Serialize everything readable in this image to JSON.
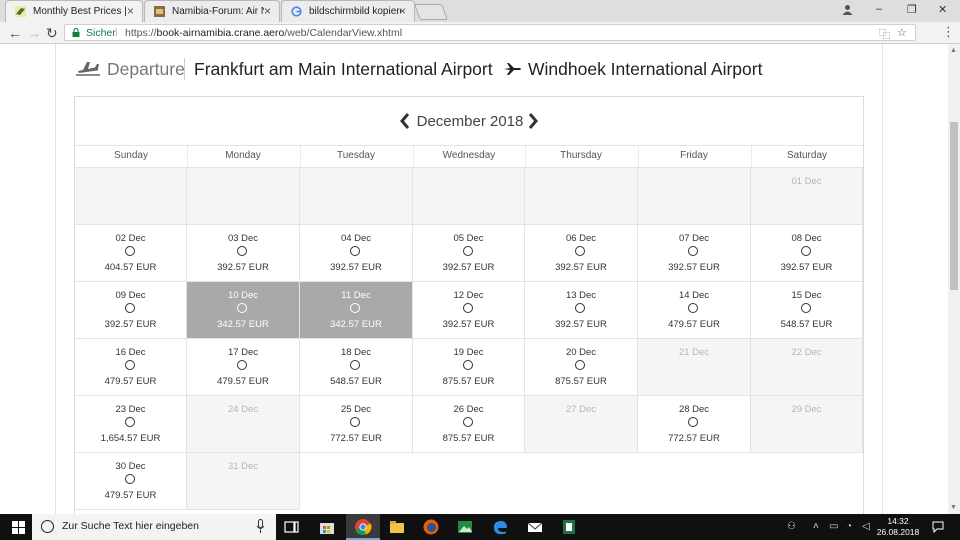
{
  "browser": {
    "tabs": [
      {
        "title": "Monthly Best Prices | Air",
        "active": true
      },
      {
        "title": "Namibia-Forum: Air Nam",
        "active": false
      },
      {
        "title": "bildschirmbild kopieren",
        "active": false
      }
    ],
    "secure_label": "Sicher",
    "url_prefix": "https://",
    "url_host": "book-airnamibia.crane.aero",
    "url_path": "/web/CalendarView.xhtml"
  },
  "header": {
    "departure_label": "Departure",
    "from": "Frankfurt am Main International Airport",
    "to": "Windhoek International Airport"
  },
  "calendar": {
    "month": "December 2018",
    "weekdays": [
      "Sunday",
      "Monday",
      "Tuesday",
      "Wednesday",
      "Thursday",
      "Friday",
      "Saturday"
    ],
    "rows": [
      [
        {
          "type": "empty"
        },
        {
          "type": "empty"
        },
        {
          "type": "empty"
        },
        {
          "type": "empty"
        },
        {
          "type": "empty"
        },
        {
          "type": "empty"
        },
        {
          "type": "na",
          "date": "01 Dec"
        }
      ],
      [
        {
          "type": "day",
          "date": "02 Dec",
          "price": "404.57 EUR"
        },
        {
          "type": "day",
          "date": "03 Dec",
          "price": "392.57 EUR"
        },
        {
          "type": "day",
          "date": "04 Dec",
          "price": "392.57 EUR"
        },
        {
          "type": "day",
          "date": "05 Dec",
          "price": "392.57 EUR"
        },
        {
          "type": "day",
          "date": "06 Dec",
          "price": "392.57 EUR"
        },
        {
          "type": "day",
          "date": "07 Dec",
          "price": "392.57 EUR"
        },
        {
          "type": "day",
          "date": "08 Dec",
          "price": "392.57 EUR"
        }
      ],
      [
        {
          "type": "day",
          "date": "09 Dec",
          "price": "392.57 EUR"
        },
        {
          "type": "sel",
          "date": "10 Dec",
          "price": "342.57 EUR"
        },
        {
          "type": "sel",
          "date": "11 Dec",
          "price": "342.57 EUR"
        },
        {
          "type": "day",
          "date": "12 Dec",
          "price": "392.57 EUR"
        },
        {
          "type": "day",
          "date": "13 Dec",
          "price": "392.57 EUR"
        },
        {
          "type": "day",
          "date": "14 Dec",
          "price": "479.57 EUR"
        },
        {
          "type": "day",
          "date": "15 Dec",
          "price": "548.57 EUR"
        }
      ],
      [
        {
          "type": "day",
          "date": "16 Dec",
          "price": "479.57 EUR"
        },
        {
          "type": "day",
          "date": "17 Dec",
          "price": "479.57 EUR"
        },
        {
          "type": "day",
          "date": "18 Dec",
          "price": "548.57 EUR"
        },
        {
          "type": "day",
          "date": "19 Dec",
          "price": "875.57 EUR"
        },
        {
          "type": "day",
          "date": "20 Dec",
          "price": "875.57 EUR"
        },
        {
          "type": "na",
          "date": "21 Dec"
        },
        {
          "type": "na",
          "date": "22 Dec"
        }
      ],
      [
        {
          "type": "day",
          "date": "23 Dec",
          "price": "1,654.57 EUR"
        },
        {
          "type": "na",
          "date": "24 Dec"
        },
        {
          "type": "day",
          "date": "25 Dec",
          "price": "772.57 EUR"
        },
        {
          "type": "day",
          "date": "26 Dec",
          "price": "875.57 EUR"
        },
        {
          "type": "na",
          "date": "27 Dec"
        },
        {
          "type": "day",
          "date": "28 Dec",
          "price": "772.57 EUR"
        },
        {
          "type": "na",
          "date": "29 Dec"
        }
      ],
      [
        {
          "type": "day",
          "date": "30 Dec",
          "price": "479.57 EUR"
        },
        {
          "type": "na",
          "date": "31 Dec"
        }
      ]
    ]
  },
  "taskbar": {
    "search_placeholder": "Zur Suche Text hier eingeben",
    "time": "14:32",
    "date": "26.08.2018"
  },
  "colors": {
    "selected_cell": "#a9a9a9",
    "unavailable_cell": "#f5f5f5",
    "secure_green": "#0b8043"
  }
}
